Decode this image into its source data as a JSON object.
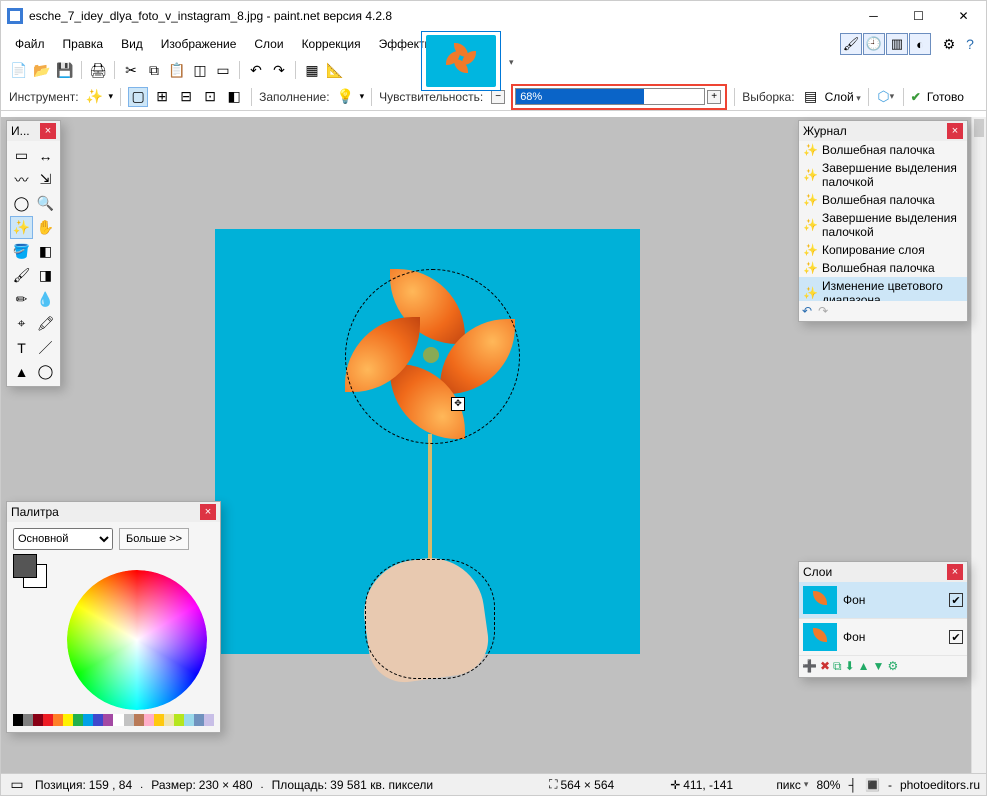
{
  "window": {
    "title": "esche_7_idey_dlya_foto_v_instagram_8.jpg - paint.net версия 4.2.8"
  },
  "menu": [
    "Файл",
    "Правка",
    "Вид",
    "Изображение",
    "Слои",
    "Коррекция",
    "Эффекты"
  ],
  "toolbar2": {
    "instrument": "Инструмент:",
    "fill": "Заполнение:",
    "tolerance": "Чувствительность:",
    "tolerance_value": "68%",
    "sampling": "Выборка:",
    "sampling_value": "Слой",
    "commit": "Готово"
  },
  "tools_panel": {
    "title": "И..."
  },
  "palette": {
    "title": "Палитра",
    "mode": "Основной",
    "more": "Больше >>",
    "hues": [
      "#000",
      "#7f7f7f",
      "#880015",
      "#ed1c24",
      "#ff7f27",
      "#fff200",
      "#22b14c",
      "#00a2e8",
      "#3f48cc",
      "#a349a4",
      "#fff",
      "#c3c3c3",
      "#b97a57",
      "#ffaec9",
      "#ffc90e",
      "#efe4b0",
      "#b5e61d",
      "#99d9ea",
      "#7092be",
      "#c8bfe7"
    ]
  },
  "history": {
    "title": "Журнал",
    "items": [
      "Волшебная палочка",
      "Завершение выделения палочкой",
      "Волшебная палочка",
      "Завершение выделения палочкой",
      "Копирование слоя",
      "Волшебная палочка",
      "Изменение цветового диапазона"
    ],
    "selected_index": 6
  },
  "layers": {
    "title": "Слои",
    "items": [
      {
        "name": "Фон",
        "visible": true
      },
      {
        "name": "Фон",
        "visible": true
      }
    ],
    "selected_index": 0
  },
  "status": {
    "pos_label": "Позиция:",
    "pos": "159 , 84",
    "size_label": "Размер:",
    "size": "230   × 480",
    "area_label": "Площадь:",
    "area": "39 581 кв. пиксели",
    "dims": "564 × 564",
    "offset": "411, -141",
    "units": "пикс",
    "zoom": "80%",
    "site": "photoeditors.ru"
  }
}
